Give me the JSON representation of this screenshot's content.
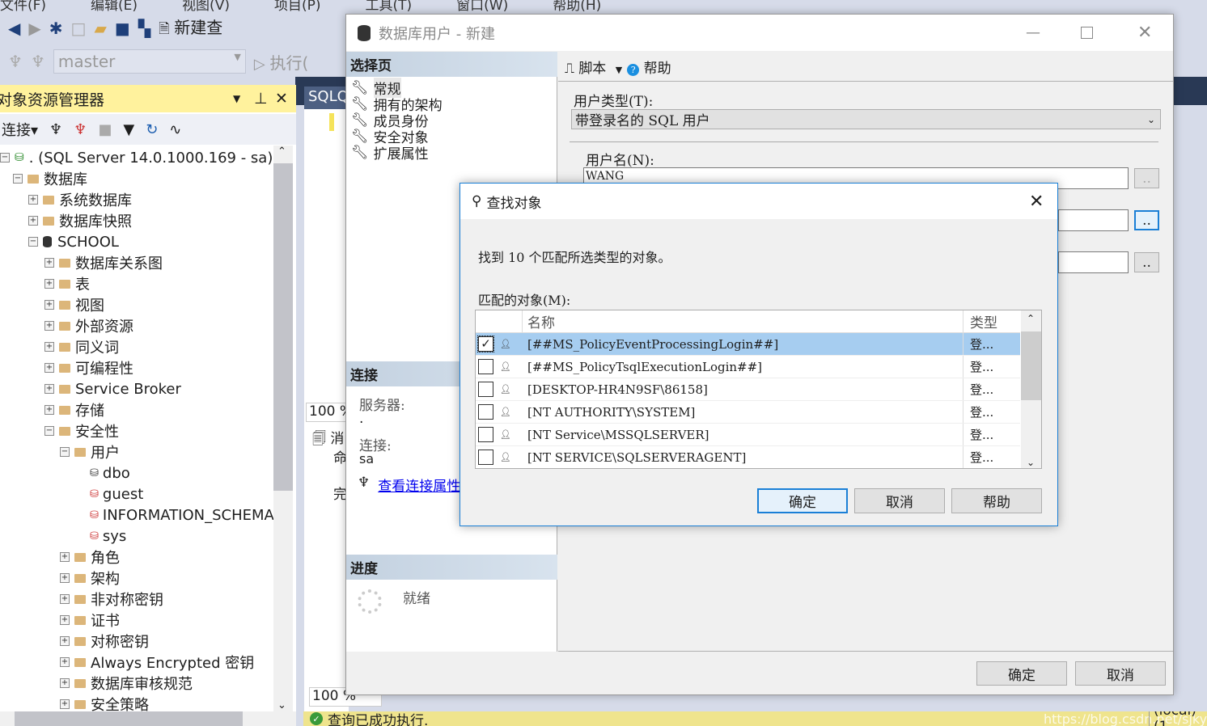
{
  "menu": [
    "文件(F)",
    "编辑(E)",
    "视图(V)",
    "项目(P)",
    "工具(T)",
    "窗口(W)",
    "帮助(H)"
  ],
  "toolbar": {
    "new_query": "新建查",
    "database": "master",
    "execute": "执行("
  },
  "object_explorer": {
    "title": "对象资源管理器",
    "connect": "连接",
    "tree": [
      {
        "label": ". (SQL Server 14.0.1000.169 - sa)",
        "level": 0,
        "exp": "−",
        "icon": "server"
      },
      {
        "label": "数据库",
        "level": 1,
        "exp": "−",
        "icon": "folder"
      },
      {
        "label": "系统数据库",
        "level": 2,
        "exp": "+",
        "icon": "folder"
      },
      {
        "label": "数据库快照",
        "level": 2,
        "exp": "+",
        "icon": "folder"
      },
      {
        "label": "SCHOOL",
        "level": 2,
        "exp": "−",
        "icon": "db"
      },
      {
        "label": "数据库关系图",
        "level": 3,
        "exp": "+",
        "icon": "folder"
      },
      {
        "label": "表",
        "level": 3,
        "exp": "+",
        "icon": "folder"
      },
      {
        "label": "视图",
        "level": 3,
        "exp": "+",
        "icon": "folder"
      },
      {
        "label": "外部资源",
        "level": 3,
        "exp": "+",
        "icon": "folder"
      },
      {
        "label": "同义词",
        "level": 3,
        "exp": "+",
        "icon": "folder"
      },
      {
        "label": "可编程性",
        "level": 3,
        "exp": "+",
        "icon": "folder"
      },
      {
        "label": "Service Broker",
        "level": 3,
        "exp": "+",
        "icon": "folder"
      },
      {
        "label": "存储",
        "level": 3,
        "exp": "+",
        "icon": "folder"
      },
      {
        "label": "安全性",
        "level": 3,
        "exp": "−",
        "icon": "folder"
      },
      {
        "label": "用户",
        "level": 4,
        "exp": "−",
        "icon": "folder"
      },
      {
        "label": "dbo",
        "level": 5,
        "exp": "",
        "icon": "user"
      },
      {
        "label": "guest",
        "level": 5,
        "exp": "",
        "icon": "user-disabled"
      },
      {
        "label": "INFORMATION_SCHEMA",
        "level": 5,
        "exp": "",
        "icon": "user-disabled"
      },
      {
        "label": "sys",
        "level": 5,
        "exp": "",
        "icon": "user-disabled"
      },
      {
        "label": "角色",
        "level": 4,
        "exp": "+",
        "icon": "folder"
      },
      {
        "label": "架构",
        "level": 4,
        "exp": "+",
        "icon": "folder"
      },
      {
        "label": "非对称密钥",
        "level": 4,
        "exp": "+",
        "icon": "folder"
      },
      {
        "label": "证书",
        "level": 4,
        "exp": "+",
        "icon": "folder"
      },
      {
        "label": "对称密钥",
        "level": 4,
        "exp": "+",
        "icon": "folder"
      },
      {
        "label": "Always Encrypted 密钥",
        "level": 4,
        "exp": "+",
        "icon": "folder"
      },
      {
        "label": "数据库审核规范",
        "level": 4,
        "exp": "+",
        "icon": "folder"
      },
      {
        "label": "安全策略",
        "level": 4,
        "exp": "+",
        "icon": "folder"
      }
    ]
  },
  "editor": {
    "tab": "SQLQ",
    "zoom1": "100 %",
    "messages": "消",
    "msg_line1": "命",
    "msg_line2": "完",
    "zoom2": "100 %",
    "status": "查询已成功执行.",
    "server_status": "(local) (1",
    "watermark": "https://blog.csdn.net/sjkylzy"
  },
  "user_dialog": {
    "title": "数据库用户 - 新建",
    "select_page": "选择页",
    "pages": [
      "常规",
      "拥有的架构",
      "成员身份",
      "安全对象",
      "扩展属性"
    ],
    "script": "脚本",
    "help": "帮助",
    "user_type_label": "用户类型(T):",
    "user_type_value": "带登录名的 SQL 用户",
    "user_name_label": "用户名(N):",
    "user_name_value": "WANG",
    "browse": "..",
    "connection_header": "连接",
    "server_label": "服务器:",
    "server_value": ".",
    "conn_label": "连接:",
    "conn_value": "sa",
    "view_conn": "查看连接属性",
    "progress_header": "进度",
    "progress_status": "就绪",
    "ok": "确定",
    "cancel": "取消"
  },
  "find_dialog": {
    "title": "查找对象",
    "found_text": "找到 10 个匹配所选类型的对象。",
    "matched_label": "匹配的对象(M):",
    "columns": [
      "名称",
      "类型"
    ],
    "rows": [
      {
        "name": "[##MS_PolicyEventProcessingLogin##]",
        "type": "登...",
        "checked": true,
        "selected": true
      },
      {
        "name": "[##MS_PolicyTsqlExecutionLogin##]",
        "type": "登...",
        "checked": false
      },
      {
        "name": "[DESKTOP-HR4N9SF\\86158]",
        "type": "登...",
        "checked": false
      },
      {
        "name": "[NT AUTHORITY\\SYSTEM]",
        "type": "登...",
        "checked": false
      },
      {
        "name": "[NT Service\\MSSQLSERVER]",
        "type": "登...",
        "checked": false
      },
      {
        "name": "[NT SERVICE\\SQLSERVERAGENT]",
        "type": "登...",
        "checked": false
      }
    ],
    "ok": "确定",
    "cancel": "取消",
    "help": "帮助"
  },
  "colors": {
    "selection": "#a6cdf0",
    "accent": "#1a7fd6",
    "explorer_header": "#fff29d",
    "status_bar": "#efe48d",
    "navy": "#293955"
  }
}
